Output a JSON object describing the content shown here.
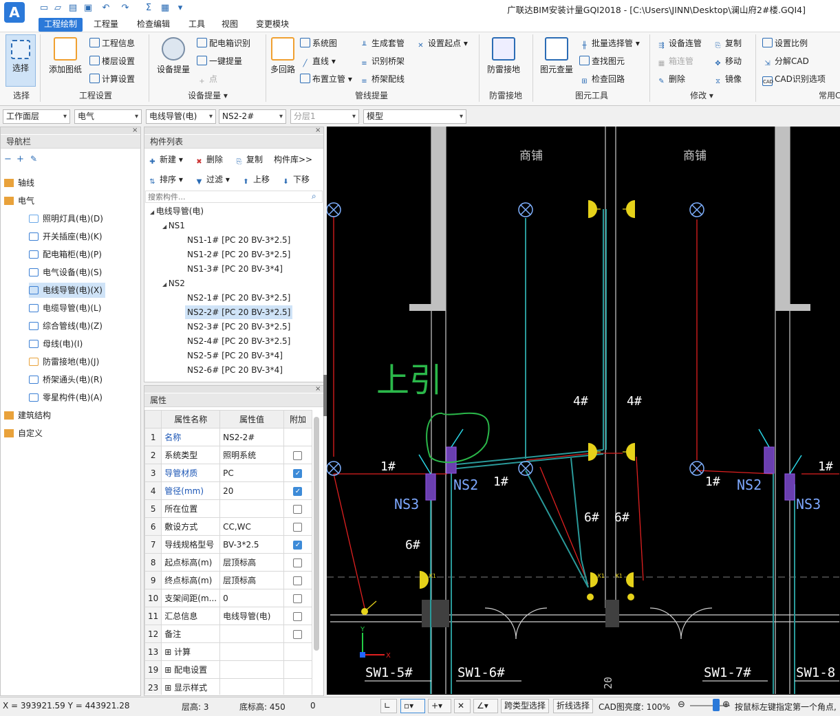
{
  "title": "广联达BIM安装计量GQI2018 - [C:\\Users\\JINN\\Desktop\\澜山府2#楼.GQI4]",
  "menu": [
    "工程绘制",
    "工程量",
    "检查编辑",
    "工具",
    "视图",
    "变更模块"
  ],
  "ribbon": {
    "select": "选择",
    "add_drawing": "添加图纸",
    "project_info": "工程信息",
    "floor_settings": "楼层设置",
    "calc_settings": "计算设置",
    "group_project_settings": "工程设置",
    "equip_extract": "设备提量",
    "box_recognize": "配电箱识别",
    "one_key": "一键提量",
    "point": "点",
    "group_equip": "设备提量",
    "multi_loop": "多回路",
    "system_diagram": "系统图",
    "straight_line": "直线",
    "vertical_pipe": "布置立管",
    "gen_sleeve": "生成套管",
    "recog_tray": "识别桥架",
    "tray_wiring": "桥架配线",
    "set_start": "设置起点",
    "group_pipe": "管线提量",
    "lightning": "防雷接地",
    "group_lightning": "防雷接地",
    "element_query": "图元查量",
    "batch_select_pipe": "批量选择管",
    "find_element": "查找图元",
    "check_loop": "检查回路",
    "group_element_tools": "图元工具",
    "equip_connect": "设备连管",
    "box_connect": "箱连管",
    "delete": "删除",
    "copy": "复制",
    "move": "移动",
    "mirror": "镜像",
    "group_modify": "修改",
    "set_scale": "设置比例",
    "split_cad": "分解CAD",
    "cad_options": "CAD识别选项",
    "group_common": "常用C"
  },
  "toolbar": {
    "layer": "工作面层",
    "discipline": "电气",
    "type": "电线导管(电)",
    "component": "NS2-2#",
    "sublayer": "分层1",
    "space": "模型"
  },
  "nav": {
    "title": "导航栏",
    "items": [
      {
        "label": "轴线",
        "level": 0
      },
      {
        "label": "电气",
        "level": 0
      },
      {
        "label": "照明灯具(电)(D)",
        "level": 1
      },
      {
        "label": "开关插座(电)(K)",
        "level": 1
      },
      {
        "label": "配电箱柜(电)(P)",
        "level": 1
      },
      {
        "label": "电气设备(电)(S)",
        "level": 1
      },
      {
        "label": "电线导管(电)(X)",
        "level": 1
      },
      {
        "label": "电缆导管(电)(L)",
        "level": 1
      },
      {
        "label": "综合管线(电)(Z)",
        "level": 1
      },
      {
        "label": "母线(电)(I)",
        "level": 1
      },
      {
        "label": "防雷接地(电)(J)",
        "level": 1
      },
      {
        "label": "桥架通头(电)(R)",
        "level": 1
      },
      {
        "label": "零星构件(电)(A)",
        "level": 1
      },
      {
        "label": "建筑结构",
        "level": 0
      },
      {
        "label": "自定义",
        "level": 0
      }
    ]
  },
  "component_list": {
    "title": "构件列表",
    "new": "新建",
    "delete": "删除",
    "copy": "复制",
    "library": "构件库>>",
    "sort": "排序",
    "filter": "过滤",
    "up": "上移",
    "down": "下移",
    "search_placeholder": "搜索构件...",
    "tree": [
      {
        "label": "电线导管(电)",
        "level": 0
      },
      {
        "label": "NS1",
        "level": 1
      },
      {
        "label": "NS1-1# [PC 20 BV-3*2.5]",
        "level": 2
      },
      {
        "label": "NS1-2# [PC 20 BV-3*2.5]",
        "level": 2
      },
      {
        "label": "NS1-3# [PC 20 BV-3*4]",
        "level": 2
      },
      {
        "label": "NS2",
        "level": 1
      },
      {
        "label": "NS2-1# [PC 20 BV-3*2.5]",
        "level": 2
      },
      {
        "label": "NS2-2# [PC 20 BV-3*2.5]",
        "level": 2
      },
      {
        "label": "NS2-3# [PC 20 BV-3*2.5]",
        "level": 2
      },
      {
        "label": "NS2-4# [PC 20 BV-3*2.5]",
        "level": 2
      },
      {
        "label": "NS2-5# [PC 20 BV-3*4]",
        "level": 2
      },
      {
        "label": "NS2-6# [PC 20 BV-3*4]",
        "level": 2
      }
    ]
  },
  "properties": {
    "title": "属性",
    "headers": [
      "属性名称",
      "属性值",
      "附加"
    ],
    "rows": [
      {
        "n": "1",
        "name": "名称",
        "val": "NS2-2#",
        "chk": "none",
        "blue": true
      },
      {
        "n": "2",
        "name": "系统类型",
        "val": "照明系统",
        "chk": "off",
        "blue": false
      },
      {
        "n": "3",
        "name": "导管材质",
        "val": "PC",
        "chk": "on",
        "blue": true
      },
      {
        "n": "4",
        "name": "管径(mm)",
        "val": "20",
        "chk": "on",
        "blue": true
      },
      {
        "n": "5",
        "name": "所在位置",
        "val": "",
        "chk": "off",
        "blue": false
      },
      {
        "n": "6",
        "name": "敷设方式",
        "val": "CC,WC",
        "chk": "off",
        "blue": false
      },
      {
        "n": "7",
        "name": "导线规格型号",
        "val": "BV-3*2.5",
        "chk": "on",
        "blue": false
      },
      {
        "n": "8",
        "name": "起点标高(m)",
        "val": "层顶标高",
        "chk": "off",
        "blue": false
      },
      {
        "n": "9",
        "name": "终点标高(m)",
        "val": "层顶标高",
        "chk": "off",
        "blue": false
      },
      {
        "n": "10",
        "name": "支架间距(m...",
        "val": "0",
        "chk": "off",
        "blue": false
      },
      {
        "n": "11",
        "name": "汇总信息",
        "val": "电线导管(电)",
        "chk": "off",
        "blue": false
      },
      {
        "n": "12",
        "name": "备注",
        "val": "",
        "chk": "off",
        "blue": false
      },
      {
        "n": "13",
        "name": "计算",
        "val": "",
        "chk": "none",
        "blue": false,
        "exp": true
      },
      {
        "n": "19",
        "name": "配电设置",
        "val": "",
        "chk": "none",
        "blue": false,
        "exp": true
      },
      {
        "n": "23",
        "name": "显示样式",
        "val": "",
        "chk": "none",
        "blue": false,
        "exp": true
      }
    ]
  },
  "cad": {
    "shop_left": "商铺",
    "shop_right": "商铺",
    "handwritten": "上引",
    "labels": {
      "ns2": "NS2",
      "ns3": "NS3",
      "n1": "1#",
      "n4": "4#",
      "n6": "6#",
      "k1": "K1"
    },
    "sw": [
      "SW1-5#",
      "SW1-6#",
      "SW1-7#",
      "SW1-8"
    ],
    "bottom_text": "20",
    "axis_x": "X",
    "axis_y": "Y"
  },
  "status": {
    "coords": "X = 393921.59 Y = 443921.28",
    "floor_height": "层高: 3",
    "base_elev": "底标高: 450",
    "zero": "0",
    "cross_select": "跨类型选择",
    "polyline_select": "折线选择",
    "cad_brightness": "CAD图亮度: 100%",
    "hint": "按鼠标左键指定第一个角点,"
  }
}
